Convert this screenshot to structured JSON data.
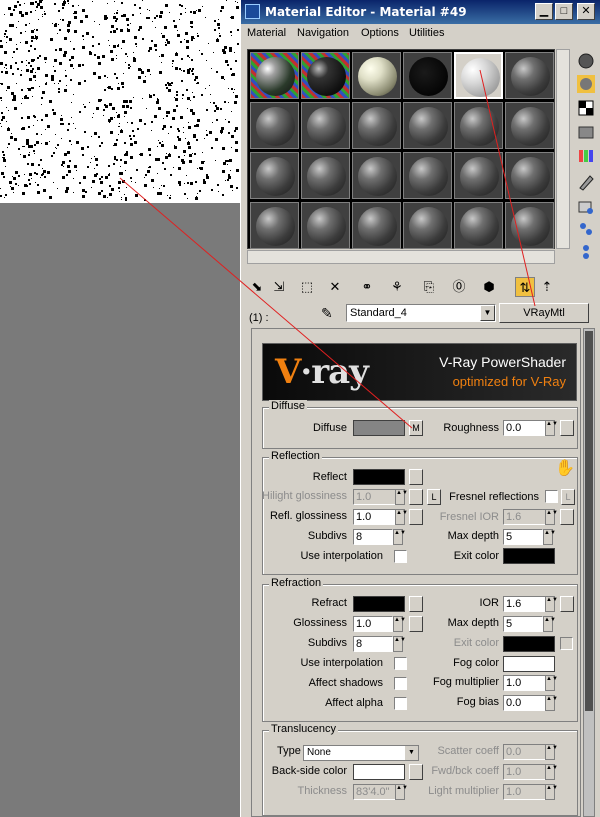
{
  "window": {
    "title": "Material Editor - Material #49",
    "app_icon": "3ds"
  },
  "menu": [
    "Material",
    "Navigation",
    "Options",
    "Utilities"
  ],
  "slots": {
    "rows": 4,
    "cols": 6,
    "selected_index": 4
  },
  "toolbar_icons": [
    "get-material-icon",
    "put-to-scene-icon",
    "assign-material-icon",
    "reset-map-icon",
    "make-unique-icon",
    "put-to-library-icon",
    "material-id-icon",
    "show-map-icon",
    "show-end-result-icon",
    "go-to-parent-icon",
    "go-forward-sibling-icon"
  ],
  "material": {
    "id_label": "(1) :",
    "name": "Standard_4",
    "type_button": "VRayMtl"
  },
  "banner": {
    "logo_prefix": "V",
    "logo_rest": "·ray",
    "line1": "V-Ray PowerShader",
    "line2": "optimized for V-Ray"
  },
  "diffuse": {
    "group": "Diffuse",
    "diffuse_label": "Diffuse",
    "diffuse_color": "#858585",
    "map_button": "M",
    "roughness_label": "Roughness",
    "roughness_value": "0.0"
  },
  "reflection": {
    "group": "Reflection",
    "reflect_label": "Reflect",
    "reflect_color": "#000000",
    "hilight_label": "Hilight glossiness",
    "hilight_value": "1.0",
    "lock_label": "L",
    "fresnel_label": "Fresnel reflections",
    "fresnel_lock": "L",
    "refl_gloss_label": "Refl. glossiness",
    "refl_gloss_value": "1.0",
    "fresnel_ior_label": "Fresnel IOR",
    "fresnel_ior_value": "1.6",
    "subdivs_label": "Subdivs",
    "subdivs_value": "8",
    "max_depth_label": "Max depth",
    "max_depth_value": "5",
    "use_interp_label": "Use interpolation",
    "exit_color_label": "Exit color",
    "exit_color": "#000000"
  },
  "refraction": {
    "group": "Refraction",
    "refract_label": "Refract",
    "refract_color": "#000000",
    "ior_label": "IOR",
    "ior_value": "1.6",
    "glossiness_label": "Glossiness",
    "glossiness_value": "1.0",
    "max_depth_label": "Max depth",
    "max_depth_value": "5",
    "subdivs_label": "Subdivs",
    "subdivs_value": "8",
    "exit_color_label": "Exit color",
    "exit_color": "#000000",
    "use_interp_label": "Use interpolation",
    "fog_color_label": "Fog color",
    "fog_color": "#ffffff",
    "affect_shadows_label": "Affect shadows",
    "fog_mult_label": "Fog multiplier",
    "fog_mult_value": "1.0",
    "affect_alpha_label": "Affect alpha",
    "fog_bias_label": "Fog bias",
    "fog_bias_value": "0.0"
  },
  "translucency": {
    "group": "Translucency",
    "type_label": "Type",
    "type_value": "None",
    "scatter_label": "Scatter coeff",
    "scatter_value": "0.0",
    "backside_label": "Back-side color",
    "backside_color": "#ffffff",
    "fwd_label": "Fwd/bck coeff",
    "fwd_value": "1.0",
    "thickness_label": "Thickness",
    "thickness_value": "83'4.0\"",
    "light_mult_label": "Light multiplier",
    "light_mult_value": "1.0"
  }
}
